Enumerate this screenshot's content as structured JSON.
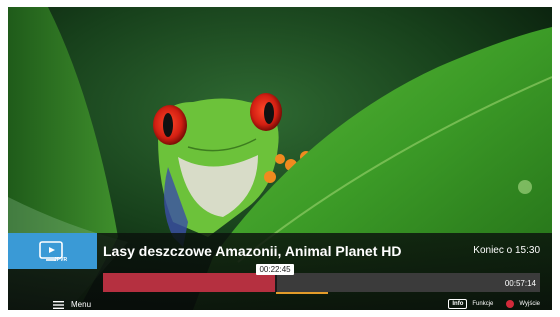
{
  "program": {
    "title": "Lasy deszczowe Amazonii, Animal Planet HD",
    "end_time": "Koniec o 15:30"
  },
  "pvr": {
    "icon": "pvr-icon",
    "label": "JPVR"
  },
  "playback": {
    "current_time": "00:22:45",
    "total_time": "00:57:14",
    "progress_fraction": 0.397,
    "buffer_fraction": 0.514,
    "fill_color": "#b53040",
    "buffer_color": "#e39c2a"
  },
  "menu": {
    "icon": "hamburger-icon",
    "label": "Menu"
  },
  "legend": {
    "info_key": "Info",
    "info_label": "Funkcje",
    "exit_color": "#d22a3a",
    "exit_label": "Wyjście"
  },
  "colors": {
    "accent": "#3a9ad6"
  }
}
